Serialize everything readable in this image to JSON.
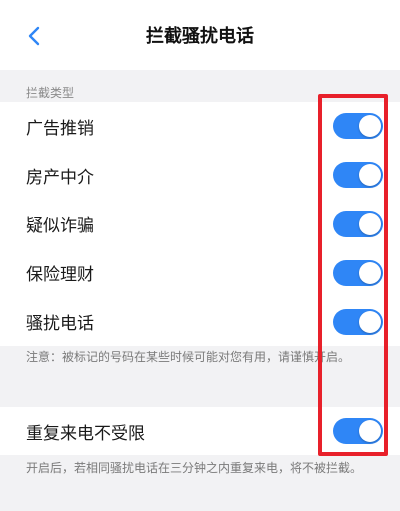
{
  "header": {
    "title": "拦截骚扰电话"
  },
  "section": {
    "label": "拦截类型"
  },
  "block_types": [
    {
      "label": "广告推销",
      "enabled": true
    },
    {
      "label": "房产中介",
      "enabled": true
    },
    {
      "label": "疑似诈骗",
      "enabled": true
    },
    {
      "label": "保险理财",
      "enabled": true
    },
    {
      "label": "骚扰电话",
      "enabled": true
    }
  ],
  "note1": "注意：被标记的号码在某些时候可能对您有用，请谨慎开启。",
  "repeat_call": {
    "label": "重复来电不受限",
    "enabled": true
  },
  "note2": "开启后，若相同骚扰电话在三分钟之内重复来电，将不被拦截。",
  "colors": {
    "toggle_on": "#2f86f6",
    "highlight": "#e8202a"
  }
}
